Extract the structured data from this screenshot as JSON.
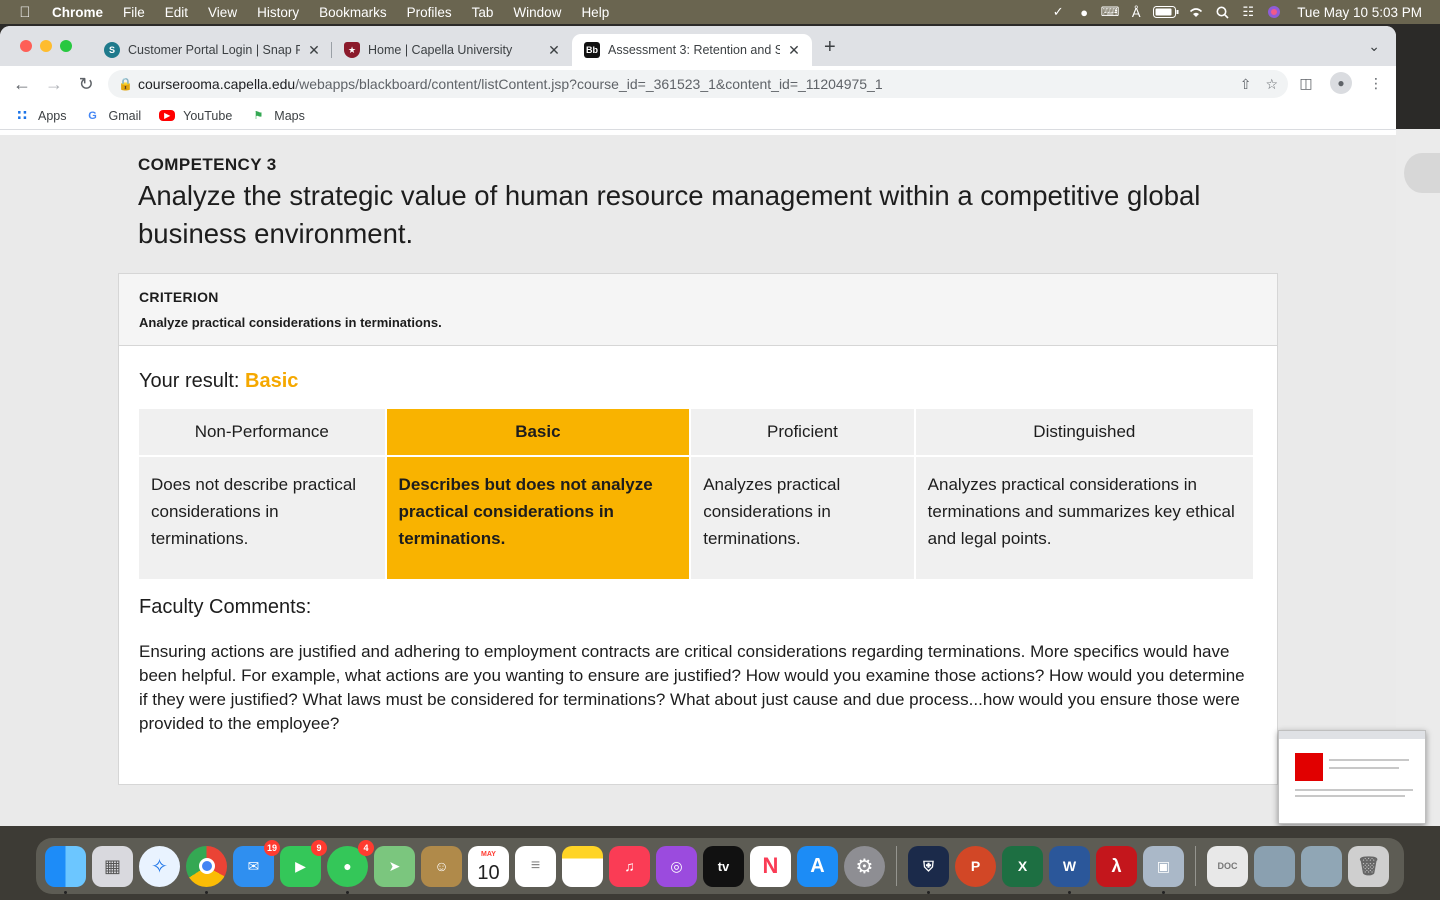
{
  "menubar": {
    "app_name": "Chrome",
    "items": [
      "File",
      "Edit",
      "View",
      "History",
      "Bookmarks",
      "Profiles",
      "Tab",
      "Window",
      "Help"
    ],
    "clock": "Tue May 10  5:03 PM"
  },
  "tabs": [
    {
      "title": "Customer Portal Login | Snap F",
      "favicon": "snap-favicon"
    },
    {
      "title": "Home | Capella University",
      "favicon": "capella-favicon"
    },
    {
      "title": "Assessment 3: Retention and S",
      "favicon": "blackboard-favicon"
    }
  ],
  "address_bar": {
    "host": "courserooma.capella.edu",
    "path": "/webapps/blackboard/content/listContent.jsp?course_id=_361523_1&content_id=_11204975_1"
  },
  "bookmarks": [
    {
      "label": "Apps"
    },
    {
      "label": "Gmail"
    },
    {
      "label": "YouTube"
    },
    {
      "label": "Maps"
    }
  ],
  "page": {
    "competency_label": "COMPETENCY 3",
    "competency_title": "Analyze the strategic value of human resource management within a competitive global business environment.",
    "criterion_label": "CRITERION",
    "criterion_text": "Analyze practical considerations in terminations.",
    "result_prefix": "Your result:",
    "result_value": "Basic",
    "rubric": {
      "levels": [
        "Non-Performance",
        "Basic",
        "Proficient",
        "Distinguished"
      ],
      "descriptions": [
        "Does not describe practical considerations in terminations.",
        "Describes but does not analyze practical considerations in terminations.",
        "Analyzes practical considerations in terminations.",
        "Analyzes practical considerations in terminations and summarizes key ethical and legal points."
      ],
      "selected_index": 1
    },
    "faculty_title": "Faculty Comments:",
    "faculty_comment": "Ensuring actions are justified and adhering to employment contracts are critical considerations regarding terminations. More specifics would have been helpful. For example, what actions are you wanting to ensure are justified? How would you examine those actions? How would you determine if they were justified? What laws must be considered for terminations? What about just cause and due process...how would you ensure those were provided to the employee?"
  },
  "dock": {
    "badges": {
      "mail": "19",
      "facetime": "9",
      "messages": "4"
    },
    "calendar_month": "MAY",
    "calendar_day": "10",
    "tv_label": "tv"
  },
  "colors": {
    "accent_selected": "#f9b300",
    "result_text": "#f5a800"
  }
}
